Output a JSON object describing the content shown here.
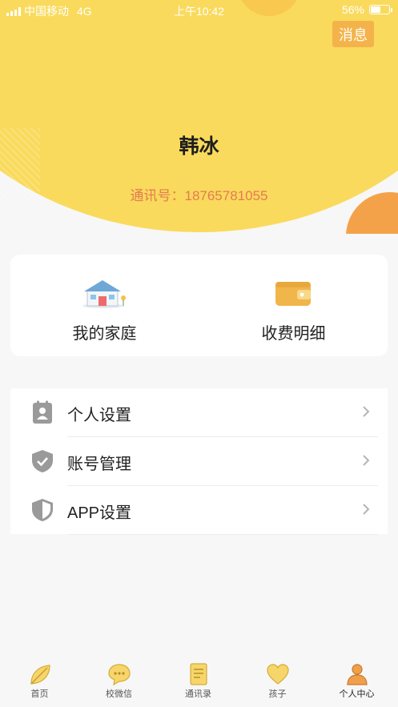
{
  "status_bar": {
    "carrier": "中国移动",
    "network": "4G",
    "time": "上午10:42",
    "battery": "56%",
    "battery_level": 0.56
  },
  "header": {
    "message_button": "消息",
    "user_name": "韩冰",
    "contact_id": "通讯号：18765781055"
  },
  "quick_card": {
    "items": [
      {
        "label": "我的家庭",
        "icon": "house-icon"
      },
      {
        "label": "收费明细",
        "icon": "wallet-icon"
      }
    ]
  },
  "settings_list": {
    "items": [
      {
        "label": "个人设置",
        "icon": "contact-card-icon"
      },
      {
        "label": "账号管理",
        "icon": "shield-check-icon"
      },
      {
        "label": "APP设置",
        "icon": "shield-icon"
      }
    ]
  },
  "tab_bar": {
    "tabs": [
      {
        "label": "首页",
        "icon": "leaf-icon"
      },
      {
        "label": "校微信",
        "icon": "chat-bubble-icon"
      },
      {
        "label": "通讯录",
        "icon": "address-book-icon"
      },
      {
        "label": "孩子",
        "icon": "heart-icon"
      },
      {
        "label": "个人中心",
        "icon": "person-icon",
        "active": true
      }
    ]
  },
  "colors": {
    "header_yellow": "#f9da5c",
    "accent_orange": "#f4b34a",
    "id_text": "#e47b52",
    "tab_active": "#f0a04b"
  }
}
